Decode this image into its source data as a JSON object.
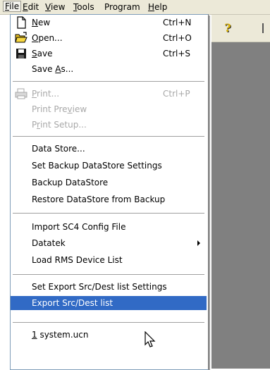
{
  "menubar": {
    "items": [
      {
        "label": "File",
        "ul": "F",
        "rest": "ile"
      },
      {
        "label": "Edit",
        "ul": "E",
        "rest": "dit"
      },
      {
        "label": "View",
        "ul": "V",
        "rest": "iew"
      },
      {
        "label": "Tools",
        "ul": "T",
        "rest": "ools"
      },
      {
        "label": "Program",
        "ul": "",
        "rest": "Program"
      },
      {
        "label": "Help",
        "ul": "H",
        "rest": "elp"
      }
    ]
  },
  "file_menu": {
    "new": {
      "ul": "N",
      "rest": "ew",
      "shortcut": "Ctrl+N"
    },
    "open": {
      "ul": "O",
      "rest": "pen...",
      "shortcut": "Ctrl+O"
    },
    "save": {
      "ul": "S",
      "rest": "ave",
      "shortcut": "Ctrl+S"
    },
    "save_as": {
      "pre": "Save ",
      "ul": "A",
      "rest": "s..."
    },
    "print": {
      "ul": "P",
      "rest": "rint...",
      "shortcut": "Ctrl+P",
      "disabled": true
    },
    "print_preview": {
      "pre": "Print Pre",
      "ul": "v",
      "rest": "iew",
      "disabled": true
    },
    "print_setup": {
      "pre": "P",
      "ul": "r",
      "rest": "int Setup...",
      "disabled": true
    },
    "data_store": "Data Store...",
    "set_backup": "Set Backup DataStore Settings",
    "backup": "Backup DataStore",
    "restore": "Restore DataStore from Backup",
    "import_sc4": "Import SC4 Config File",
    "datatek": "Datatek",
    "load_rms": "Load RMS Device List",
    "set_export": "Set Export Src/Dest list Settings",
    "export": "Export Src/Dest list",
    "recent": {
      "ul": "1",
      "rest": " system.ucn"
    }
  },
  "colors": {
    "highlight": "#316ac5",
    "menubar_bg": "#ece9d8",
    "workspace": "#808080",
    "disabled_text": "#a8a8a8"
  },
  "icons": [
    "new-document-icon",
    "open-folder-icon",
    "save-disk-icon",
    "printer-icon",
    "help-icon",
    "mouse-cursor-icon"
  ]
}
